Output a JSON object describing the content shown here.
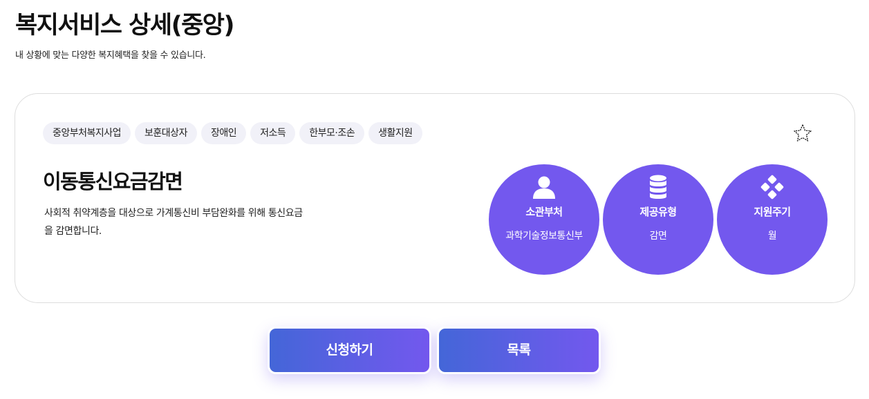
{
  "header": {
    "title": "복지서비스 상세(중앙)",
    "subtitle": "내 상황에 맞는 다양한 복지혜택을 찾을 수 있습니다."
  },
  "service": {
    "tags": [
      "중앙부처복지사업",
      "보훈대상자",
      "장애인",
      "저소득",
      "한부모·조손",
      "생활지원"
    ],
    "title": "이동통신요금감면",
    "description": "사회적 취약계층을 대상으로 가계통신비 부담완화를 위해 통신요금을 감면합니다.",
    "favorite_icon": "star-outline-icon",
    "info": [
      {
        "label": "소관부처",
        "value": "과학기술정보통신부",
        "icon": "person-icon"
      },
      {
        "label": "제공유형",
        "value": "감면",
        "icon": "coins-stack-icon"
      },
      {
        "label": "지원주기",
        "value": "월",
        "icon": "diamond-dots-icon"
      }
    ]
  },
  "actions": {
    "apply_label": "신청하기",
    "list_label": "목록"
  },
  "colors": {
    "accent": "#7358ee",
    "gradient_start": "#4466d8",
    "tag_bg": "#f1f1f8"
  }
}
